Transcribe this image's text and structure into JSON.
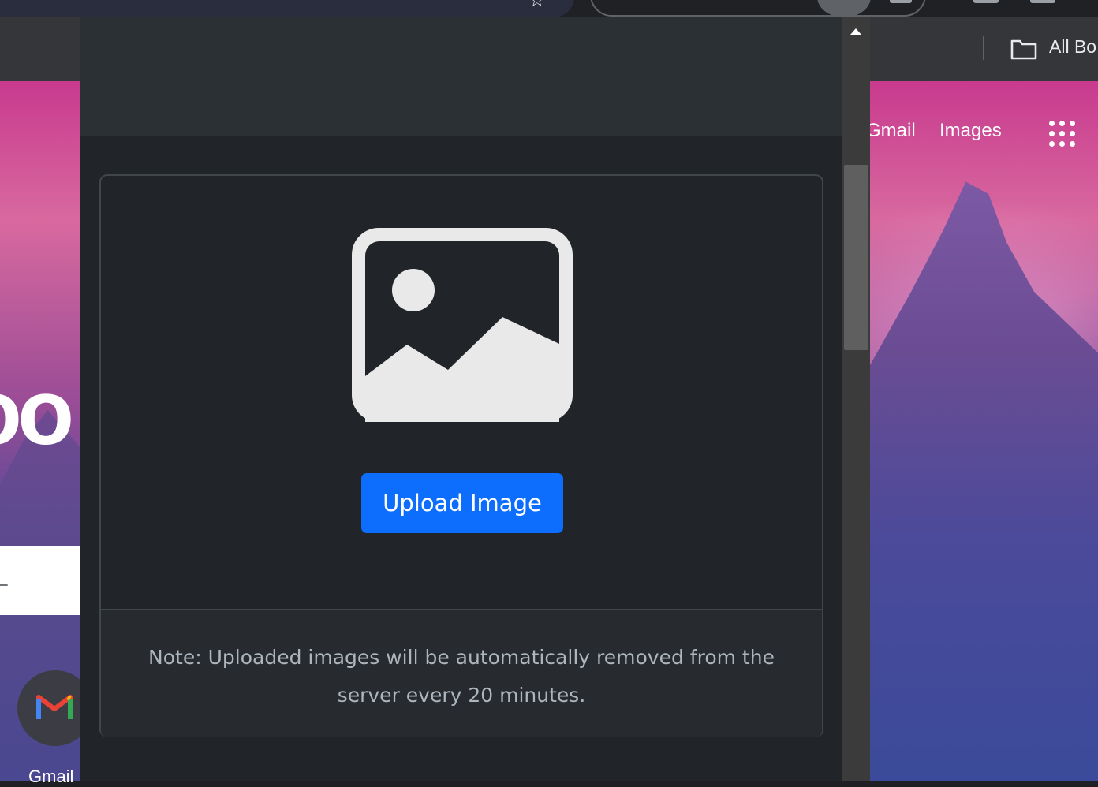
{
  "bookmarks_bar": {
    "all_bookmarks_label": "All Bo"
  },
  "new_tab_page": {
    "gmail_link": "Gmail",
    "images_link": "Images",
    "logo_fragment": "oo",
    "search_fragment": "L",
    "shortcut_label": "Gmail"
  },
  "popup": {
    "upload_button_label": "Upload Image",
    "note_text": "Note: Uploaded images will be automatically removed from the server every 20 minutes.",
    "accent_color": "#0d6efd"
  },
  "icons": [
    "star-icon",
    "folder-icon",
    "apps-grid-icon",
    "image-placeholder-icon",
    "gmail-icon",
    "scroll-up-arrow-icon"
  ]
}
